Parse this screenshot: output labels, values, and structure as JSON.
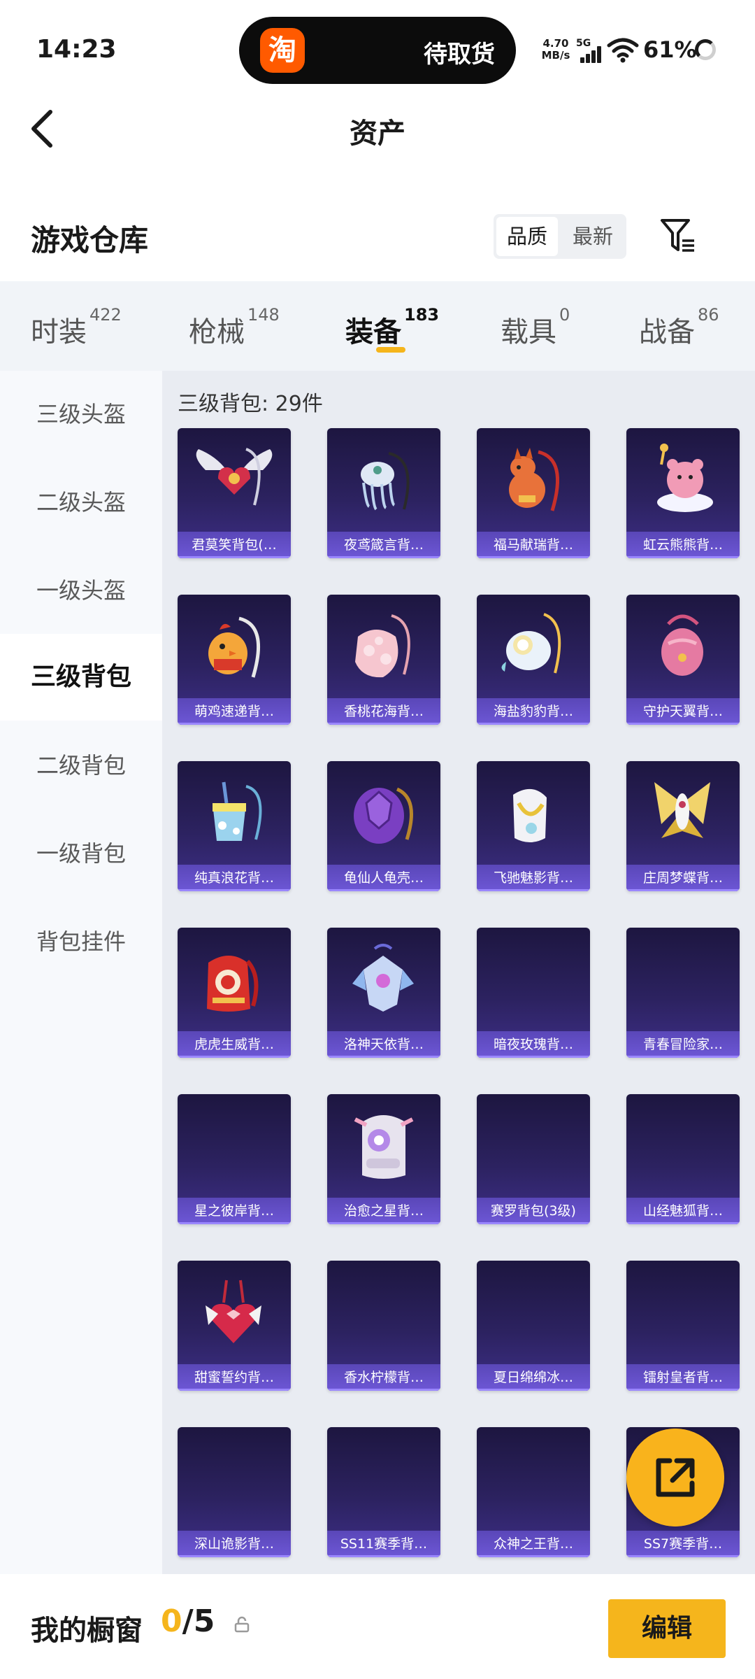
{
  "status_bar": {
    "time": "14:23",
    "island_icon": "淘",
    "island_text": "待取货",
    "net_speed_value": "4.70",
    "net_speed_unit": "MB/s",
    "network": "5G",
    "battery": "61%"
  },
  "header": {
    "title": "资产"
  },
  "warehouse": {
    "title": "游戏仓库",
    "sort_options": [
      "品质",
      "最新"
    ],
    "sort_selected": "品质"
  },
  "tabs": [
    {
      "label": "时装",
      "count": "422"
    },
    {
      "label": "枪械",
      "count": "148"
    },
    {
      "label": "装备",
      "count": "183"
    },
    {
      "label": "载具",
      "count": "0"
    },
    {
      "label": "战备",
      "count": "86"
    }
  ],
  "active_tab": "装备",
  "sidebar": {
    "items": [
      "三级头盔",
      "二级头盔",
      "一级头盔",
      "三级背包",
      "二级背包",
      "一级背包",
      "背包挂件"
    ],
    "active": "三级背包"
  },
  "grid": {
    "header": "三级背包: 29件",
    "items": [
      {
        "name": "君莫笑背包(…",
        "icon": "winged-heart-backpack"
      },
      {
        "name": "夜鸢箴言背…",
        "icon": "jellyfish-backpack"
      },
      {
        "name": "福马献瑞背…",
        "icon": "orange-horse-backpack"
      },
      {
        "name": "虹云熊熊背…",
        "icon": "pink-bear-cloud-backpack"
      },
      {
        "name": "萌鸡速递背…",
        "icon": "chick-backpack"
      },
      {
        "name": "香桃花海背…",
        "icon": "peach-blossom-backpack"
      },
      {
        "name": "海盐豹豹背…",
        "icon": "seal-backpack"
      },
      {
        "name": "守护天翼背…",
        "icon": "pink-egg-backpack"
      },
      {
        "name": "纯真浪花背…",
        "icon": "drink-cup-backpack"
      },
      {
        "name": "龟仙人龟壳…",
        "icon": "turtle-shell-backpack"
      },
      {
        "name": "飞驰魅影背…",
        "icon": "white-gold-backpack"
      },
      {
        "name": "庄周梦蝶背…",
        "icon": "golden-butterfly-backpack"
      },
      {
        "name": "虎虎生威背…",
        "icon": "red-tiger-backpack"
      },
      {
        "name": "洛神天依背…",
        "icon": "crystal-wing-backpack"
      },
      {
        "name": "暗夜玫瑰背…",
        "icon": ""
      },
      {
        "name": "青春冒险家…",
        "icon": ""
      },
      {
        "name": "星之彼岸背…",
        "icon": ""
      },
      {
        "name": "治愈之星背…",
        "icon": "nurse-robot-backpack"
      },
      {
        "name": "赛罗背包(3级)",
        "icon": ""
      },
      {
        "name": "山经魅狐背…",
        "icon": ""
      },
      {
        "name": "甜蜜誓约背…",
        "icon": "bow-heart-backpack"
      },
      {
        "name": "香水柠檬背…",
        "icon": ""
      },
      {
        "name": "夏日绵绵冰…",
        "icon": ""
      },
      {
        "name": "镭射皇者背…",
        "icon": ""
      },
      {
        "name": "深山诡影背…",
        "icon": ""
      },
      {
        "name": "SS11赛季背…",
        "icon": ""
      },
      {
        "name": "众神之王背…",
        "icon": ""
      },
      {
        "name": "SS7赛季背…",
        "icon": ""
      }
    ]
  },
  "showcase": {
    "title": "我的橱窗",
    "count_current": "0",
    "count_sep_total": "/5",
    "edit_label": "编辑"
  },
  "colors": {
    "accent": "#f5b51c",
    "card_bg": "#2c2260",
    "card_label": "#6d57d6"
  }
}
